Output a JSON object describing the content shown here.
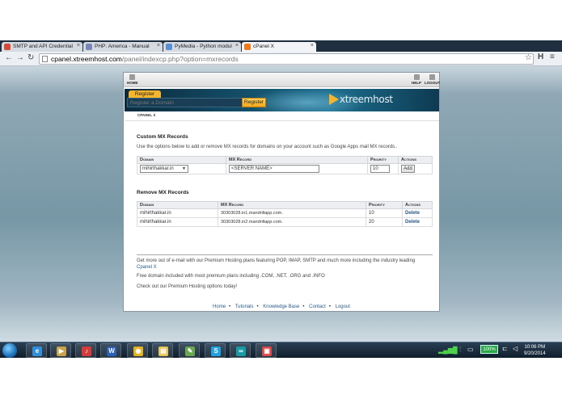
{
  "browser": {
    "tabs": [
      {
        "label": "SMTP and API Credential",
        "favicon_color": "#d64937",
        "active": false
      },
      {
        "label": "PHP: America - Manual",
        "favicon_color": "#7a86b8",
        "active": false
      },
      {
        "label": "PyMedia - Python modul",
        "favicon_color": "#5a8fd6",
        "active": false
      },
      {
        "label": "cPanel X",
        "favicon_color": "#f07a1a",
        "active": true
      }
    ],
    "url_host": "cpanel.xtreemhost.com",
    "url_path": "/panel/indexcp.php?option=mxrecords"
  },
  "cpanel": {
    "top_icons": {
      "home": "HOME",
      "help": "HELP",
      "logout": "LOGOUT"
    },
    "register_tab": "Register",
    "register_placeholder": "Register a Domain",
    "register_button": "Register",
    "logo_text": "xtreemhost",
    "breadcrumb": "CPANEL X",
    "custom": {
      "title": "Custom MX Records",
      "description": "Use the options below to add or remove MX records for domains on your account such as Google Apps mail MX records..",
      "headers": {
        "domain": "Domain",
        "mx": "MX Record",
        "priority": "Priority",
        "actions": "Actions"
      },
      "domain_value": "mihirthakkar.in",
      "mx_value": "<SERVER NAME>",
      "priority_value": "10",
      "add_label": "Add"
    },
    "remove": {
      "title": "Remove MX Records",
      "headers": {
        "domain": "Domain",
        "mx": "MX Record",
        "priority": "Priority",
        "actions": "Actions"
      },
      "rows": [
        {
          "domain": "mihirthakkar.in",
          "mx": "30303028.in1.mandrillapp.com.",
          "priority": "10",
          "action": "Delete"
        },
        {
          "domain": "mihirthakkar.in",
          "mx": "30303028.in2.mandrillapp.com.",
          "priority": "20",
          "action": "Delete"
        }
      ]
    },
    "promo": {
      "line1": "Get more out of e-mail with our Premium Hosting plans featuring POP, IMAP, SMTP and much more including the industry leading",
      "line1_link": "Cpanel X",
      "line2": "Free domain included with most premium plans including .COM, .NET, .ORG and .INFO",
      "line3": "Check out our Premium Hosting options today!"
    },
    "footer": [
      "Home",
      "Tutorials",
      "Knowledge Base",
      "Contact",
      "Logout"
    ]
  },
  "taskbar": {
    "apps": [
      {
        "name": "internet-explorer",
        "glyph": "e",
        "color": "#2f8fd8"
      },
      {
        "name": "media-player",
        "glyph": "▶",
        "color": "#c9a24a"
      },
      {
        "name": "itunes",
        "glyph": "♪",
        "color": "#d83a3a"
      },
      {
        "name": "word",
        "glyph": "W",
        "color": "#2b5fb8"
      },
      {
        "name": "chrome",
        "glyph": "◉",
        "color": "#e4b21c"
      },
      {
        "name": "explorer",
        "glyph": "▤",
        "color": "#e6c45a"
      },
      {
        "name": "notepad",
        "glyph": "✎",
        "color": "#6aa84f"
      },
      {
        "name": "skype",
        "glyph": "S",
        "color": "#1fa3e0"
      },
      {
        "name": "arduino",
        "glyph": "∞",
        "color": "#1a9ba3"
      },
      {
        "name": "media-app",
        "glyph": "▣",
        "color": "#d94a4a"
      }
    ],
    "battery": "100%",
    "time": "10:06 PM",
    "date": "9/20/2014"
  }
}
